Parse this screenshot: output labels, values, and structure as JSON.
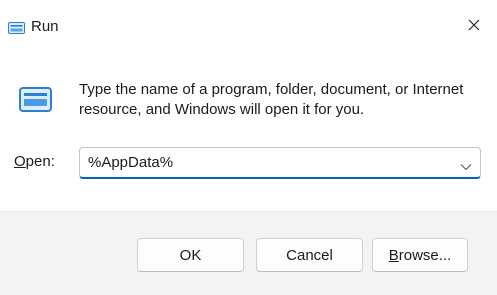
{
  "window": {
    "title": "Run",
    "title_icon": "run-icon",
    "close_icon": "close-icon"
  },
  "content": {
    "description": "Type the name of a program, folder, document, or Internet resource, and Windows will open it for you.",
    "big_icon": "run-icon"
  },
  "open_field": {
    "label_mnemonic": "O",
    "label_rest": "pen:",
    "value": "%AppData%",
    "dropdown_icon": "chevron-down-icon"
  },
  "buttons": {
    "ok": "OK",
    "cancel": "Cancel",
    "browse_mnemonic": "B",
    "browse_rest": "rowse..."
  },
  "colors": {
    "accent": "#0067c0",
    "icon_blue": "#3a8fd6",
    "footer_bg": "#f3f3f3"
  }
}
